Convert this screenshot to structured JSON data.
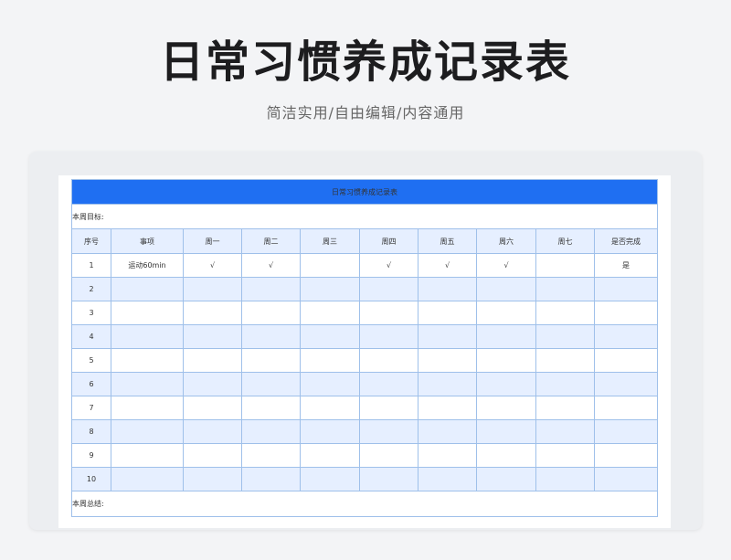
{
  "page": {
    "title": "日常习惯养成记录表",
    "subtitle": "简洁实用/自由编辑/内容通用"
  },
  "sheet": {
    "title": "日常习惯养成记录表",
    "goal_label": "本周目标:",
    "summary_label": "本周总结:",
    "headers": [
      "序号",
      "事项",
      "周一",
      "周二",
      "周三",
      "周四",
      "周五",
      "周六",
      "周七",
      "是否完成"
    ],
    "rows": [
      [
        "1",
        "运动60min",
        "√",
        "√",
        "",
        "√",
        "√",
        "√",
        "",
        "是"
      ],
      [
        "2",
        "",
        "",
        "",
        "",
        "",
        "",
        "",
        "",
        ""
      ],
      [
        "3",
        "",
        "",
        "",
        "",
        "",
        "",
        "",
        "",
        ""
      ],
      [
        "4",
        "",
        "",
        "",
        "",
        "",
        "",
        "",
        "",
        ""
      ],
      [
        "5",
        "",
        "",
        "",
        "",
        "",
        "",
        "",
        "",
        ""
      ],
      [
        "6",
        "",
        "",
        "",
        "",
        "",
        "",
        "",
        "",
        ""
      ],
      [
        "7",
        "",
        "",
        "",
        "",
        "",
        "",
        "",
        "",
        ""
      ],
      [
        "8",
        "",
        "",
        "",
        "",
        "",
        "",
        "",
        "",
        ""
      ],
      [
        "9",
        "",
        "",
        "",
        "",
        "",
        "",
        "",
        "",
        ""
      ],
      [
        "10",
        "",
        "",
        "",
        "",
        "",
        "",
        "",
        "",
        ""
      ]
    ]
  },
  "colors": {
    "title_bar": "#1f6ff2",
    "header_fill": "#e6efff",
    "grid_line": "#9fc0ea"
  }
}
